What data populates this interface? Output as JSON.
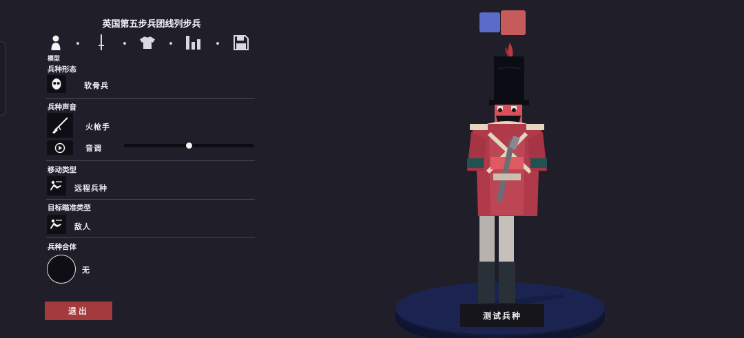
{
  "unit_title": "英国第五步兵团线列步兵",
  "tabs": [
    {
      "icon": "person-icon",
      "label": "模型"
    },
    {
      "icon": "sword-icon"
    },
    {
      "icon": "shirt-icon"
    },
    {
      "icon": "stats-icon"
    },
    {
      "icon": "save-icon"
    }
  ],
  "active_tab_label": "模型",
  "sections": {
    "unit_form": {
      "label": "兵种形态",
      "value": "软骨兵",
      "icon": "face-icon"
    },
    "unit_voice": {
      "label": "兵种声音",
      "value": "火枪手",
      "icon": "musket-icon"
    },
    "pitch": {
      "label": "音调",
      "icon": "play-icon",
      "level": 0.5
    },
    "movement": {
      "label": "移动类型",
      "value": "远程兵种",
      "icon": "ranged-unit-icon"
    },
    "targeting": {
      "label": "目标瞄准类型",
      "value": "敌人",
      "icon": "target-enemy-icon"
    },
    "combine": {
      "label": "兵种合体",
      "value": "无"
    }
  },
  "exit_label": "退出",
  "test_label": "测试兵种",
  "colors": {
    "team_blue": "#5b6bc8",
    "team_red": "#c75a5a",
    "exit_button": "#a33a3c",
    "background": "#201f29"
  }
}
